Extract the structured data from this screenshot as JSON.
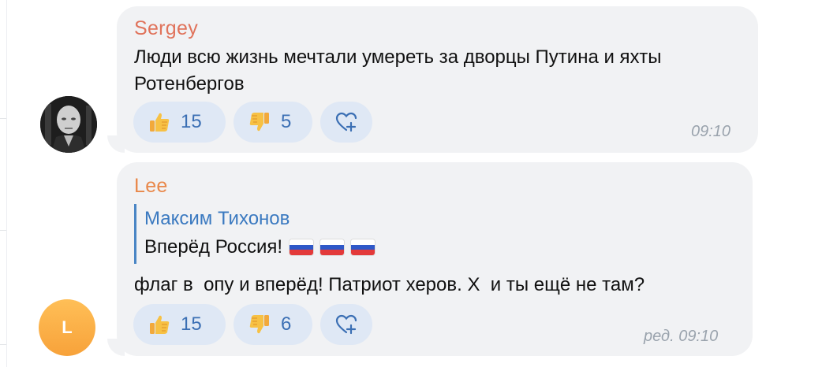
{
  "messages": [
    {
      "author": "Sergey",
      "text_line1": "Люди всю жизнь мечтали умереть за дворцы Путина и яхты",
      "text_line2": "Ротенбергов",
      "likes": "15",
      "dislikes": "5",
      "time": "09:10"
    },
    {
      "author": "Lee",
      "avatar_letter": "L",
      "quote": {
        "author": "Максим Тихонов",
        "text": "Вперёд Россия!"
      },
      "text": "флаг в  опу и вперёд! Патриот херов. Х  и ты ещё не там?",
      "likes": "15",
      "dislikes": "6",
      "time": "ред. 09:10"
    }
  ],
  "icons": {
    "like": "thumbs-up-icon",
    "dislike": "thumbs-down-icon",
    "add_reaction": "heart-plus-icon",
    "flag": "russian-flag-emoji"
  },
  "colors": {
    "bubble": "#f1f2f4",
    "reaction_bg": "#dfe8f5",
    "reaction_count": "#3b6fb4",
    "author_sergey": "#e0735b",
    "author_lee": "#e9884a",
    "quote_accent": "#3a79c0",
    "timestamp": "#9aa3ad"
  }
}
